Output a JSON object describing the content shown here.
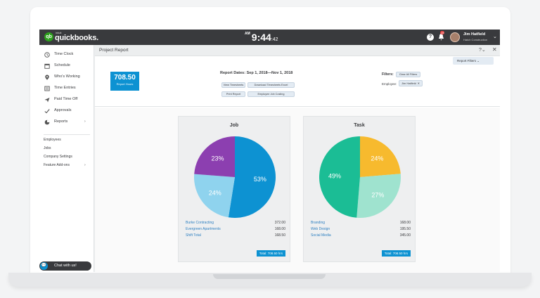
{
  "app": {
    "brand_small": "intuit",
    "brand": "quickbooks.",
    "clock_ampm": "AM",
    "clock_time": "9:44",
    "clock_seconds": ":42",
    "notification_count": "15",
    "user_name": "Jim Hatfield",
    "user_company": "Hatch Construction"
  },
  "sidebar": {
    "items": [
      {
        "label": "Time Clock",
        "icon": "clock-icon"
      },
      {
        "label": "Schedule",
        "icon": "calendar-icon"
      },
      {
        "label": "Who's Working",
        "icon": "location-pin-icon"
      },
      {
        "label": "Time Entries",
        "icon": "list-icon"
      },
      {
        "label": "Paid Time Off",
        "icon": "plane-icon"
      },
      {
        "label": "Approvals",
        "icon": "check-icon"
      },
      {
        "label": "Reports",
        "icon": "pie-icon"
      }
    ],
    "sub_items": [
      "Employees",
      "Jobs",
      "Company Settings",
      "Feature Add-ons"
    ]
  },
  "page": {
    "title": "Project Report",
    "report_filters_label": "Report Filters"
  },
  "summary": {
    "hours_value": "708.50",
    "hours_label": "Report Hours",
    "report_dates": "Report Dates: Sep 1, 2018—Nov 1, 2018",
    "buttons": [
      "View Timesheets",
      "Download Timesheets Excel",
      "Print Report",
      "Employee Job Costing"
    ],
    "filters_label": "Filters:",
    "clear_filters": "Clear All Filters",
    "employee_label": "Employee:",
    "employee_value": "Jim Hatfield"
  },
  "chart_data": [
    {
      "type": "pie",
      "title": "Job",
      "categories": [
        "Burke Contracting",
        "Evergreen Apartments",
        "Shift Total"
      ],
      "values": [
        372.0,
        168.0,
        168.5
      ],
      "percent_labels": [
        "53%",
        "24%",
        "23%"
      ],
      "value_labels": [
        "372.00",
        "168.00",
        "168.50"
      ],
      "colors": [
        "#0d92d2",
        "#8fd3ee",
        "#8c3fb0"
      ],
      "total": "Total: 708.50 hrs"
    },
    {
      "type": "pie",
      "title": "Task",
      "categories": [
        "Branding",
        "Web Design",
        "Social Media"
      ],
      "values": [
        168.0,
        195.5,
        345.0
      ],
      "percent_labels": [
        "24%",
        "27%",
        "49%"
      ],
      "value_labels": [
        "168.00",
        "195.50",
        "345.00"
      ],
      "colors": [
        "#f7ba2e",
        "#9fe3cf",
        "#1bbd95"
      ],
      "total": "Total: 708.50 hrs"
    }
  ],
  "chat": {
    "label": "Chat with us!"
  }
}
